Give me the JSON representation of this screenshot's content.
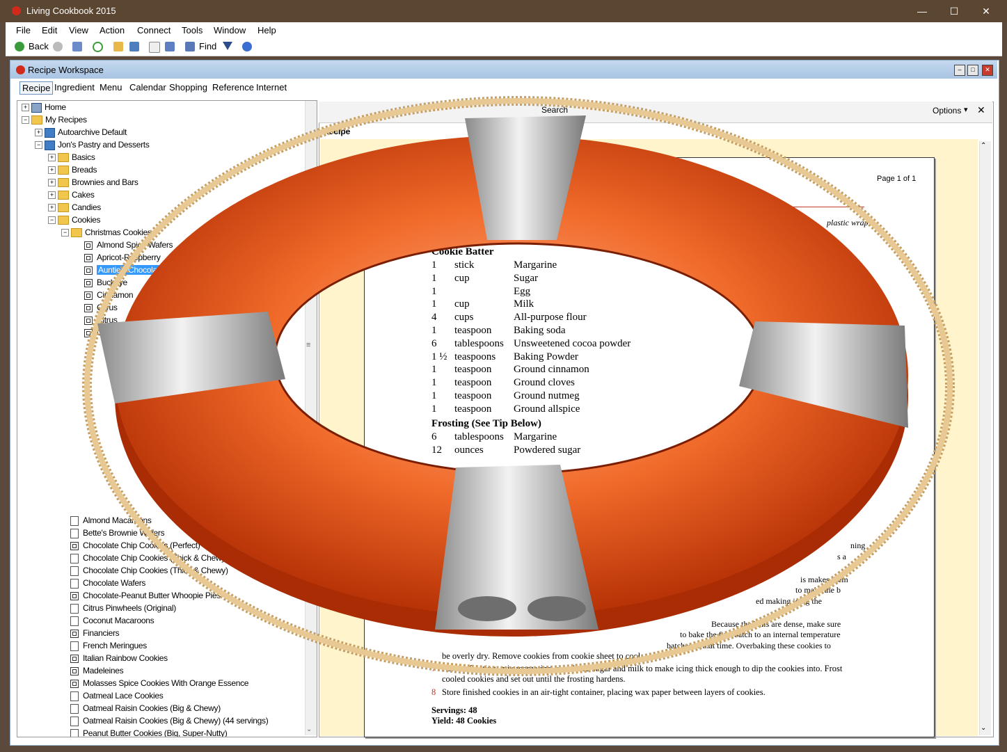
{
  "window": {
    "title": "Living Cookbook 2015",
    "controls": [
      "—",
      "☐",
      "✕"
    ]
  },
  "menu": [
    "File",
    "Edit",
    "View",
    "Action",
    "Connect",
    "Tools",
    "Window",
    "Help"
  ],
  "toolbar": {
    "back": "Back",
    "find": "Find"
  },
  "workspace": {
    "title": "Recipe Workspace",
    "tabs": [
      "Recipe",
      "Ingredient",
      "Menu",
      "Calendar",
      "Shopping",
      "Reference",
      "Internet"
    ]
  },
  "tree": {
    "items": [
      {
        "label": "Home"
      },
      {
        "label": "My Recipes"
      },
      {
        "label": "Autoarchive Default"
      },
      {
        "label": "Jon's Pastry and Desserts"
      },
      {
        "label": "Basics"
      },
      {
        "label": "Breads"
      },
      {
        "label": "Brownies and Bars"
      },
      {
        "label": "Cakes"
      },
      {
        "label": "Candies"
      },
      {
        "label": "Cookies"
      },
      {
        "label": "Christmas Cookies"
      },
      {
        "label": "Almond Spice Wafers"
      },
      {
        "label": "Apricot-Raspberry"
      },
      {
        "label": "Auntie's Chocolate"
      },
      {
        "label": "Buckeye"
      },
      {
        "label": "Cinnamon"
      },
      {
        "label": "Citrus"
      },
      {
        "label": "Citrus"
      },
      {
        "label": "Co"
      },
      {
        "label": "Almond Macaroons"
      },
      {
        "label": "Bette's Brownie Wafers"
      },
      {
        "label": "Chocolate Chip Cookies (Perfect)"
      },
      {
        "label": "Chocolate Chip Cookies (Thick & Chewy)"
      },
      {
        "label": "Chocolate Chip Cookies (Thick & Chewy)"
      },
      {
        "label": "Chocolate Wafers"
      },
      {
        "label": "Chocolate-Peanut Butter Whoopie Pies"
      },
      {
        "label": "Citrus Pinwheels (Original)"
      },
      {
        "label": "Coconut Macaroons"
      },
      {
        "label": "Financiers"
      },
      {
        "label": "French Meringues"
      },
      {
        "label": "Italian Rainbow Cookies"
      },
      {
        "label": "Madeleines"
      },
      {
        "label": "Molasses Spice Cookies With Orange Essence"
      },
      {
        "label": "Oatmeal Lace Cookies"
      },
      {
        "label": "Oatmeal Raisin Cookies (Big & Chewy)"
      },
      {
        "label": "Oatmeal Raisin Cookies (Big & Chewy) (44 servings)"
      },
      {
        "label": "Peanut Butter Cookies (Big, Super-Nutty)"
      }
    ]
  },
  "right": {
    "search_label": "Search",
    "options": "Options",
    "recipe_tab": "Recipe",
    "page": "Page 1 of 1",
    "tip_fragment": "plastic wrap"
  },
  "recipe": {
    "sections": [
      "Cookie Batter",
      "Frosting (See Tip Below)"
    ],
    "batter": [
      {
        "q": "1",
        "u": "stick",
        "n": "Margarine"
      },
      {
        "q": "1",
        "u": "cup",
        "n": "Sugar"
      },
      {
        "q": "1",
        "u": "",
        "n": "Egg"
      },
      {
        "q": "1",
        "u": "cup",
        "n": "Milk"
      },
      {
        "q": "4",
        "u": "cups",
        "n": "All-purpose flour"
      },
      {
        "q": "1",
        "u": "teaspoon",
        "n": "Baking soda"
      },
      {
        "q": "6",
        "u": "tablespoons",
        "n": "Unsweetened cocoa powder"
      },
      {
        "q": "1 ½",
        "u": "teaspoons",
        "n": "Baking Powder"
      },
      {
        "q": "1",
        "u": "teaspoon",
        "n": "Ground cinnamon"
      },
      {
        "q": "1",
        "u": "teaspoon",
        "n": "Ground cloves"
      },
      {
        "q": "1",
        "u": "teaspoon",
        "n": "Ground nutmeg"
      },
      {
        "q": "1",
        "u": "teaspoon",
        "n": "Ground allspice"
      }
    ],
    "frosting": [
      {
        "q": "6",
        "u": "tablespoons",
        "n": "Margarine"
      },
      {
        "q": "12",
        "u": "ounces",
        "n": "Powdered sugar"
      }
    ],
    "steps": [
      {
        "num": "",
        "txt": "be overly dry. Remove cookies from cookie sheet to cool."
      },
      {
        "num": "7",
        "txt": "For the frosting, mix margarine, powdered sugar and milk to make icing thick enough to dip the cookies into. Frost cooled cookies and set out until the frosting hardens."
      },
      {
        "num": "8",
        "txt": "Store finished cookies in an air-tight container, placing wax paper between layers of cookies."
      }
    ],
    "servings": "Servings: 48",
    "yield": "Yield: 48 Cookies",
    "right_fragments": [
      "ning",
      "s a",
      "is makes them",
      "to make the b",
      "ed making icing the",
      "Because the balls are dense, make sure",
      "to bake the first batch to an internal temperature",
      "batches to that time. Overbaking these cookies to"
    ]
  },
  "colors": {
    "ring": "#e8490f",
    "band": "#c8c8c8",
    "rope": "#d9b886"
  }
}
